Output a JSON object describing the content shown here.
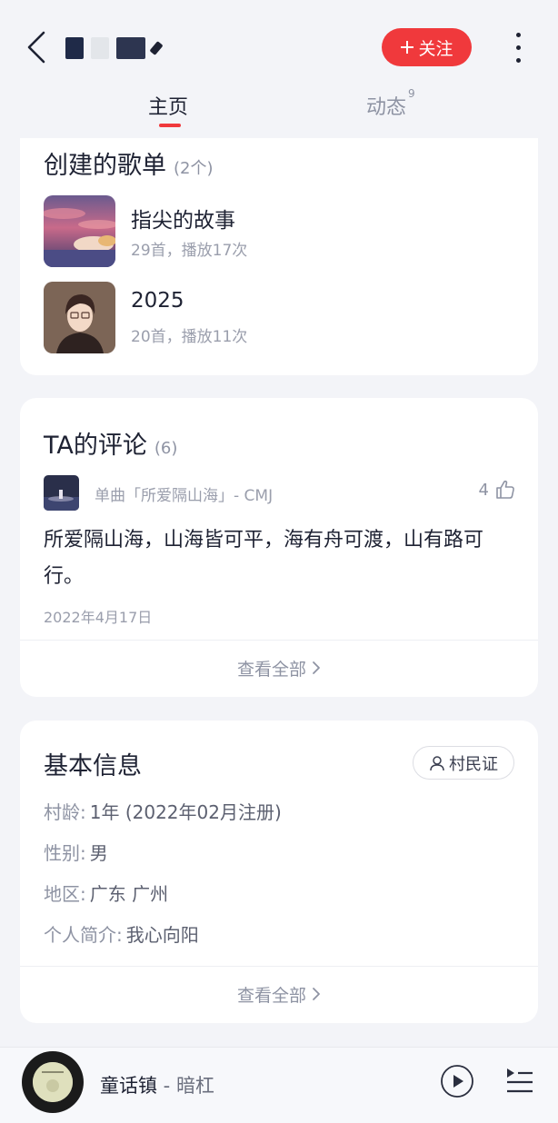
{
  "header": {
    "follow_label": "关注",
    "tabs": [
      {
        "label": "主页",
        "active": true
      },
      {
        "label": "动态",
        "badge": "9",
        "active": false
      }
    ]
  },
  "playlists": {
    "title": "创建的歌单",
    "count": "(2个)",
    "items": [
      {
        "name": "指尖的故事",
        "meta": "29首，播放17次"
      },
      {
        "name": "2025",
        "meta": "20首，播放11次"
      }
    ]
  },
  "comments": {
    "title": "TA的评论",
    "count": "(6)",
    "song_label": "单曲「所爱隔山海」- CMJ",
    "likes": "4",
    "text": "所爱隔山海，山海皆可平，海有舟可渡，山有路可行。",
    "date": "2022年4月17日",
    "view_all": "查看全部"
  },
  "info": {
    "title": "基本信息",
    "villager_label": "村民证",
    "rows": [
      {
        "label": "村龄:",
        "value": "1年 (2022年02月注册)"
      },
      {
        "label": "性别:",
        "value": "男"
      },
      {
        "label": "地区:",
        "value": "广东 广州"
      },
      {
        "label": "个人简介:",
        "value": "我心向阳"
      }
    ],
    "view_all": "查看全部"
  },
  "player": {
    "song": "童话镇",
    "separator": " - ",
    "artist": "暗杠"
  },
  "colors": {
    "accent": "#f0393c",
    "text_primary": "#1e2233",
    "text_secondary": "#8e93a3",
    "background": "#f3f4f8"
  }
}
